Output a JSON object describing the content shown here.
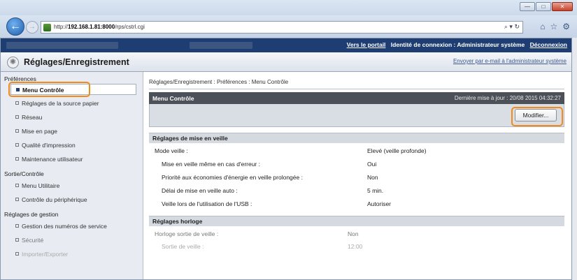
{
  "browser": {
    "address_prefix": "http://",
    "address_host": "192.168.1.81:8000",
    "address_path": "/rps/cstrl.cgi",
    "address_tools": "⌕ ▾ ↻",
    "win_min": "—",
    "win_max": "□",
    "win_close": "✕"
  },
  "topbar": {
    "portal_link": "Vers le portail",
    "login_identity": "Identité de connexion : Administrateur système",
    "logout_link": "Déconnexion"
  },
  "header": {
    "title": "Réglages/Enregistrement",
    "email_link": "Envoyer par e-mail à l'administrateur système"
  },
  "sidebar": {
    "sections": [
      {
        "label": "Préférences",
        "items": [
          "Menu Contrôle",
          "Réglages de la source papier",
          "Réseau",
          "Mise en page",
          "Qualité d'impression",
          "Maintenance utilisateur"
        ]
      },
      {
        "label": "Sortie/Contrôle",
        "items": [
          "Menu Utilitaire",
          "Contrôle du périphérique"
        ]
      },
      {
        "label": "Réglages de gestion",
        "items": [
          "Gestion des numéros de service",
          "Sécurité",
          "Importer/Exporter"
        ]
      }
    ]
  },
  "content": {
    "breadcrumb": "Réglages/Enregistrement : Préférences : Menu Contrôle",
    "panel_title": "Menu Contrôle",
    "last_update": "Dernière mise à jour : 20/08 2015 04:32:27",
    "modify_button": "Modifier...",
    "sleep_section": {
      "title": "Réglages de mise en veille",
      "rows": [
        {
          "label": "Mode veille :",
          "value": "Elevé (veille profonde)"
        },
        {
          "label": "Mise en veille même en cas d'erreur :",
          "value": "Oui"
        },
        {
          "label": "Priorité aux économies d'énergie en veille prolongée :",
          "value": "Non"
        },
        {
          "label": "Délai de mise en veille auto :",
          "value": "5 min."
        },
        {
          "label": "Veille lors de l'utilisation de l'USB :",
          "value": "Autoriser"
        }
      ]
    },
    "clock_section": {
      "title": "Réglages horloge",
      "rows": [
        {
          "label": "Horloge sortie de veille :",
          "value": "Non"
        },
        {
          "label": "Sortie de veille :",
          "value": "12:00"
        }
      ]
    }
  },
  "colors": {
    "accent_highlight": "#f28a1a",
    "topbar": "#1e3d72"
  }
}
